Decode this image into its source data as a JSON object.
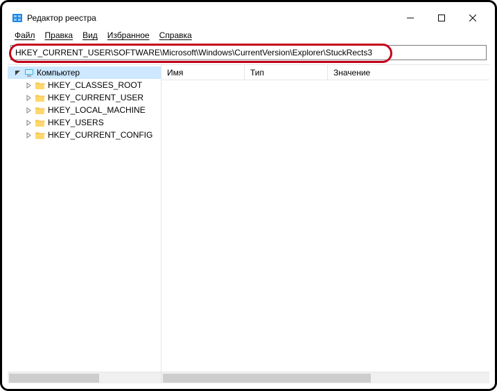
{
  "window": {
    "title": "Редактор реестра",
    "minimize_tip": "Minimize",
    "maximize_tip": "Maximize",
    "close_tip": "Close"
  },
  "menubar": {
    "items": [
      "Файл",
      "Правка",
      "Вид",
      "Избранное",
      "Справка"
    ]
  },
  "address": {
    "value": "HKEY_CURRENT_USER\\SOFTWARE\\Microsoft\\Windows\\CurrentVersion\\Explorer\\StuckRects3"
  },
  "tree": {
    "root": "Компьютер",
    "children": [
      "HKEY_CLASSES_ROOT",
      "HKEY_CURRENT_USER",
      "HKEY_LOCAL_MACHINE",
      "HKEY_USERS",
      "HKEY_CURRENT_CONFIG"
    ]
  },
  "columns": {
    "name": "Имя",
    "type": "Тип",
    "value": "Значение"
  }
}
